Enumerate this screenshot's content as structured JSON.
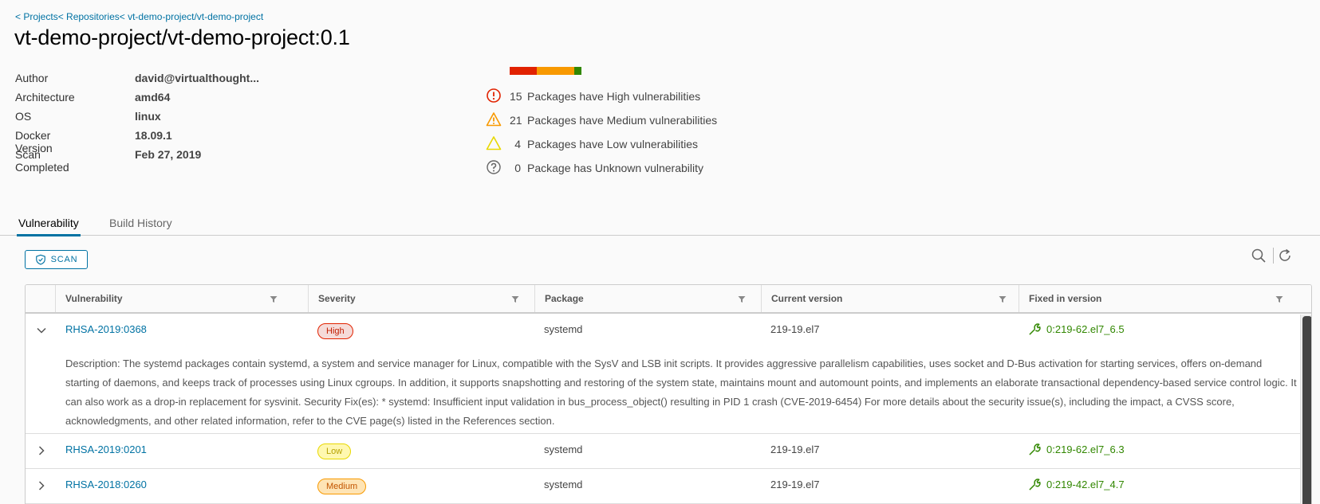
{
  "breadcrumb": [
    "< Projects",
    "< Repositories",
    "< vt-demo-project/vt-demo-project"
  ],
  "title": "vt-demo-project/vt-demo-project:0.1",
  "properties": [
    {
      "label": "Author",
      "value": "david@virtualthought..."
    },
    {
      "label": "Architecture",
      "value": "amd64"
    },
    {
      "label": "OS",
      "value": "linux"
    },
    {
      "label": "Docker Version",
      "value": "18.09.1"
    },
    {
      "label": "Scan Completed",
      "value": "Feb 27, 2019"
    }
  ],
  "vuln_summary": {
    "distribution": [
      {
        "level": "high",
        "count": 15,
        "color": "#e12200"
      },
      {
        "level": "medium",
        "count": 21,
        "color": "#f89900"
      },
      {
        "level": "low",
        "count": 4,
        "color": "#318700"
      },
      {
        "level": "unknown",
        "count": 0,
        "color": "#318700"
      }
    ],
    "rows": [
      {
        "icon": "high-severity-icon",
        "count": "15",
        "text": "Packages have High vulnerabilities"
      },
      {
        "icon": "medium-severity-icon",
        "count": "21",
        "text": "Packages have Medium vulnerabilities"
      },
      {
        "icon": "low-severity-icon",
        "count": "4",
        "text": "Packages have Low vulnerabilities"
      },
      {
        "icon": "unknown-severity-icon",
        "count": "0",
        "text": "Package has Unknown vulnerability"
      }
    ]
  },
  "tabs": {
    "vulnerability": "Vulnerability",
    "build_history": "Build History"
  },
  "scan_button": "SCAN",
  "table": {
    "columns": [
      "Vulnerability",
      "Severity",
      "Package",
      "Current version",
      "Fixed in version"
    ],
    "rows": [
      {
        "id": "RHSA-2019:0368",
        "severity": "High",
        "package": "systemd",
        "current": "219-19.el7",
        "fixed": "0:219-62.el7_6.5",
        "expanded": true,
        "description": "Description: The systemd packages contain systemd, a system and service manager for Linux, compatible with the SysV and LSB init scripts. It provides aggressive parallelism capabilities, uses socket and D-Bus activation for starting services, offers on-demand starting of daemons, and keeps track of processes using Linux cgroups. In addition, it supports snapshotting and restoring of the system state, maintains mount and automount points, and implements an elaborate transactional dependency-based service control logic. It can also work as a drop-in replacement for sysvinit. Security Fix(es): * systemd: Insufficient input validation in bus_process_object() resulting in PID 1 crash (CVE-2019-6454) For more details about the security issue(s), including the impact, a CVSS score, acknowledgments, and other related information, refer to the CVE page(s) listed in the References section."
      },
      {
        "id": "RHSA-2019:0201",
        "severity": "Low",
        "package": "systemd",
        "current": "219-19.el7",
        "fixed": "0:219-62.el7_6.3",
        "expanded": false
      },
      {
        "id": "RHSA-2018:0260",
        "severity": "Medium",
        "package": "systemd",
        "current": "219-19.el7",
        "fixed": "0:219-42.el7_4.7",
        "expanded": false
      }
    ]
  },
  "colors": {
    "link": "#0072a3",
    "high_bg": "#f5dbd9",
    "high_border": "#e12200",
    "high_text": "#c21d00",
    "medium_bg": "#fee4b5",
    "medium_border": "#f89900",
    "medium_text": "#c25400",
    "low_bg": "#fff8b0",
    "low_border": "#e8d800",
    "low_text": "#b6a000",
    "fixed": "#318700"
  }
}
